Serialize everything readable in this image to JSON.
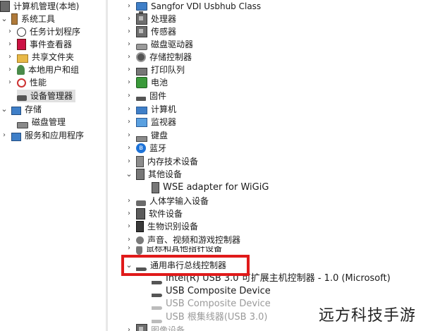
{
  "left_tree": {
    "root": "计算机管理(本地)",
    "system_tools": "系统工具",
    "items": [
      {
        "label": "任务计划程序",
        "icon": "clock-icon"
      },
      {
        "label": "事件查看器",
        "icon": "event-viewer-icon"
      },
      {
        "label": "共享文件夹",
        "icon": "folder-icon"
      },
      {
        "label": "本地用户和组",
        "icon": "users-icon"
      },
      {
        "label": "性能",
        "icon": "performance-icon"
      },
      {
        "label": "设备管理器",
        "icon": "device-manager-icon"
      }
    ],
    "storage": "存储",
    "disk_management": "磁盘管理",
    "services": "服务和应用程序"
  },
  "device_tree": {
    "categories_top": [
      {
        "label": "Sangfor VDI Usbhub Class",
        "icon": "usb-hub-icon"
      },
      {
        "label": "处理器",
        "icon": "processor-icon"
      },
      {
        "label": "传感器",
        "icon": "sensor-icon"
      },
      {
        "label": "磁盘驱动器",
        "icon": "disk-drive-icon"
      },
      {
        "label": "存储控制器",
        "icon": "storage-controller-icon"
      },
      {
        "label": "打印队列",
        "icon": "printer-icon"
      },
      {
        "label": "电池",
        "icon": "battery-icon"
      },
      {
        "label": "固件",
        "icon": "firmware-icon"
      },
      {
        "label": "计算机",
        "icon": "computer-icon"
      },
      {
        "label": "监视器",
        "icon": "monitor-icon"
      },
      {
        "label": "键盘",
        "icon": "keyboard-icon"
      },
      {
        "label": "蓝牙",
        "icon": "bluetooth-icon"
      },
      {
        "label": "内存技术设备",
        "icon": "memory-icon"
      }
    ],
    "other_devices": "其他设备",
    "other_child": "WSE adapter for WiGiG",
    "categories_mid": [
      {
        "label": "人体学输入设备",
        "icon": "hid-icon"
      },
      {
        "label": "软件设备",
        "icon": "software-device-icon"
      },
      {
        "label": "生物识别设备",
        "icon": "biometric-icon"
      },
      {
        "label": "声音、视频和游戏控制器",
        "icon": "sound-icon"
      },
      {
        "label": "鼠标和其他指针设备",
        "icon": "mouse-icon"
      }
    ],
    "usb_category": "通用串行总线控制器",
    "usb_children": [
      {
        "label": "Intel(R) USB 3.0 可扩展主机控制器 - 1.0 (Microsoft)"
      },
      {
        "label": "USB Composite Device"
      },
      {
        "label": "USB Composite Device"
      },
      {
        "label": "USB 根集线器(USB 3.0)"
      }
    ],
    "last_partial": "图像设备"
  },
  "watermark": "远方科技手游",
  "colors": {
    "highlight": "#e01a1a"
  }
}
